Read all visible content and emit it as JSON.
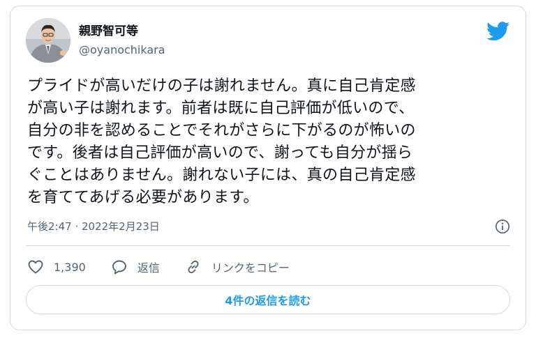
{
  "author": {
    "display_name": "親野智可等",
    "handle": "@oyanochikara"
  },
  "tweet": {
    "lines": [
      "プライドが高いだけの子は謝れません。真に自己肯定感",
      "が高い子は謝れます。前者は既に自己評価が低いので、",
      "自分の非を認めることでそれがさらに下がるのが怖いの",
      "です。後者は自己評価が高いので、謝っても自分が揺ら",
      "ぐことはありません。謝れない子には、真の自己肯定感",
      "を育ててあげる必要があります。"
    ],
    "timestamp": "午後2:47 · 2022年2月23日"
  },
  "actions": {
    "like_count": "1,390",
    "reply_label": "返信",
    "copy_link_label": "リンクをコピー"
  },
  "replies_button": "4件の返信を読む",
  "colors": {
    "brand": "#1d9bf0",
    "secondary_text": "#536471",
    "border": "#cfd9de"
  },
  "icons": [
    "twitter-bird-icon",
    "info-icon",
    "heart-icon",
    "reply-bubble-icon",
    "link-icon"
  ]
}
